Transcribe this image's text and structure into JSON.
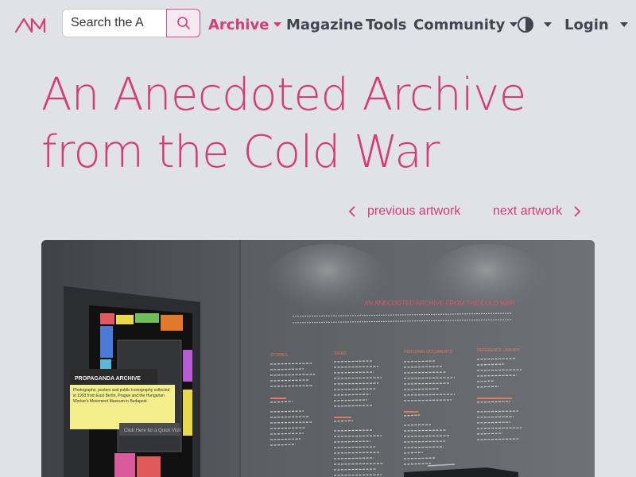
{
  "nav": {
    "search_placeholder": "Search the A",
    "items": [
      {
        "label": "Archive",
        "has_dropdown": true,
        "active": true
      },
      {
        "label": "Magazine",
        "has_dropdown": false
      },
      {
        "label": "Tools",
        "has_dropdown": false
      },
      {
        "label": "Community",
        "has_dropdown": true
      }
    ],
    "login_label": "Login"
  },
  "page": {
    "title_line1": "An Anecdoted Archive",
    "title_line2": "from the Cold War",
    "prev_label": "previous artwork",
    "next_label": "next artwork"
  },
  "hero": {
    "wall_title": "AN ANECDOTED ARCHIVE FROM THE COLD WAR",
    "panel_title": "PROPAGANDA ARCHIVE",
    "panel_text": "Photographs, posters and public iconography collected in 1993 from East Berlin, Prague and the Hungarian Worker's Movement Museum in Budapest.",
    "quick_visit": "Click Here for a Quick Visit",
    "columns": [
      {
        "heading": "STORIES"
      },
      {
        "heading": "SIGNS"
      },
      {
        "heading": "PERSONAL DOCUMENTS"
      },
      {
        "heading": "REFERENCE LIBRARY"
      }
    ]
  },
  "colors": {
    "accent": "#d63c7a",
    "text": "#3f4650",
    "background": "#dfe2e7"
  },
  "icons": {
    "logo": "archive-logo-icon",
    "search": "search-icon",
    "theme": "contrast-icon"
  }
}
